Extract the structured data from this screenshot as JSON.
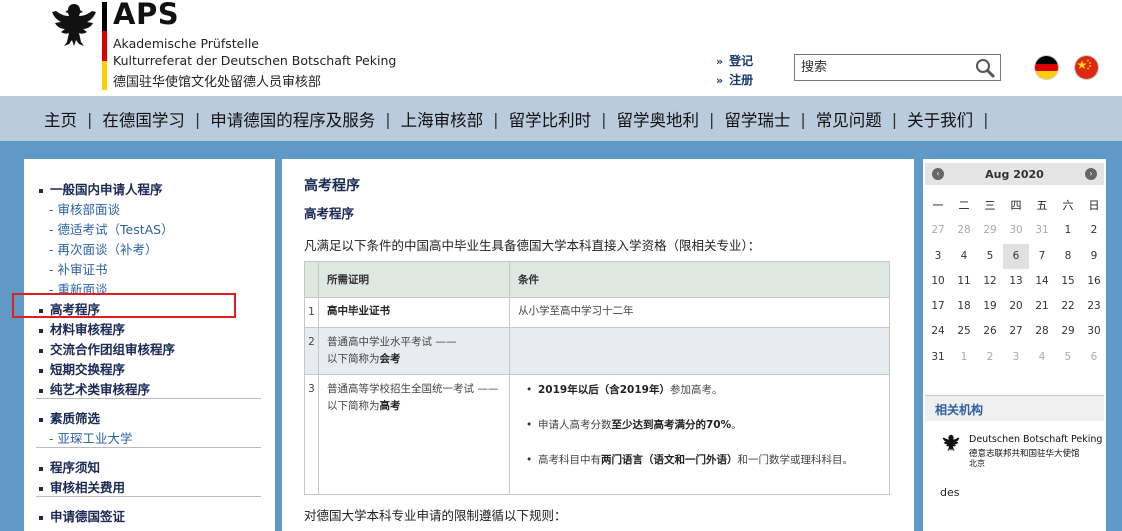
{
  "header": {
    "title": "APS",
    "subtitle_line1": "Akademische Prüfstelle",
    "subtitle_line2": "Kulturreferat der Deutschen Botschaft Peking",
    "subtitle_line3": "德国驻华使馆文化处留德人员审核部",
    "links": {
      "arrows": "»",
      "login": "登记",
      "register": "注册"
    },
    "search": {
      "placeholder": "搜索",
      "value": ""
    },
    "flags": [
      "germany-flag",
      "china-flag"
    ],
    "colors": {
      "flag_black": "#000000",
      "flag_red": "#dd0000",
      "flag_gold": "#ffce00",
      "cn_red": "#de2910",
      "cn_star": "#ffde00"
    }
  },
  "nav": {
    "separator": "|",
    "items": [
      "主页",
      "在德国学习",
      "申请德国的程序及服务",
      "上海审核部",
      "留学比利时",
      "留学奥地利",
      "留学瑞士",
      "常见问题",
      "关于我们"
    ]
  },
  "sidebar": {
    "bullet_sub_prefix": "-",
    "items": [
      {
        "label": "一般国内申请人程序",
        "level": "main"
      },
      {
        "label": "审核部面谈",
        "level": "sub"
      },
      {
        "label": "德适考试（TestAS）",
        "level": "sub"
      },
      {
        "label": "再次面谈（补考）",
        "level": "sub"
      },
      {
        "label": "补审证书",
        "level": "sub"
      },
      {
        "label": "重新面谈",
        "level": "sub"
      },
      {
        "label": "高考程序",
        "level": "main",
        "highlighted": true
      },
      {
        "label": "材料审核程序",
        "level": "main"
      },
      {
        "label": "交流合作团组审核程序",
        "level": "main"
      },
      {
        "label": "短期交换程序",
        "level": "main"
      },
      {
        "label": "纯艺术类审核程序",
        "level": "main"
      },
      {
        "label": "素质筛选",
        "level": "main"
      },
      {
        "label": "亚琛工业大学",
        "level": "sub"
      },
      {
        "label": "程序须知",
        "level": "main"
      },
      {
        "label": "审核相关费用",
        "level": "main"
      },
      {
        "label": "申请德国签证",
        "level": "main"
      }
    ]
  },
  "content": {
    "title": "高考程序",
    "subtitle": "高考程序",
    "intro": "凡满足以下条件的中国高中毕业生具备德国大学本科直接入学资格（限相关专业）：",
    "table": {
      "headers": [
        "所需证明",
        "条件"
      ],
      "rows": [
        {
          "num": "1",
          "req": "高中毕业证书",
          "cond": "从小学至高中学习十二年"
        },
        {
          "num": "2",
          "req_line1": "普通高中学业水平考试 ——",
          "req_line2_prefix": "以下简称为",
          "req_line2_bold": "会考"
        },
        {
          "num": "3",
          "req_line1": "普通高等学校招生全国统一考试 ——",
          "req_line2_prefix": "以下简称为",
          "req_line2_bold": "高考",
          "conds": [
            {
              "bold": "2019年以后（含2019年）",
              "rest": "参加高考。"
            },
            {
              "pre": "申请人高考分数",
              "bold": "至少达到高考满分的70%",
              "rest": "。"
            },
            {
              "pre": "高考科目中有",
              "bold": "两门语言（语文和一门外语）",
              "rest": "和一门数学或理科科目。"
            }
          ]
        }
      ]
    },
    "footer": "对德国大学本科专业申请的限制遵循以下规则："
  },
  "calendar": {
    "month_label": "Aug 2020",
    "prev": "‹",
    "next": "›",
    "weekdays": [
      "一",
      "二",
      "三",
      "四",
      "五",
      "六",
      "日"
    ],
    "weeks": [
      [
        27,
        28,
        29,
        30,
        31,
        1,
        2
      ],
      [
        3,
        4,
        5,
        6,
        7,
        8,
        9
      ],
      [
        10,
        11,
        12,
        13,
        14,
        15,
        16
      ],
      [
        17,
        18,
        19,
        20,
        21,
        22,
        23
      ],
      [
        24,
        25,
        26,
        27,
        28,
        29,
        30
      ],
      [
        31,
        1,
        2,
        3,
        4,
        5,
        6
      ]
    ],
    "other_month": [
      [
        0,
        0
      ],
      [
        0,
        1
      ],
      [
        0,
        2
      ],
      [
        0,
        3
      ],
      [
        0,
        4
      ],
      [
        5,
        1
      ],
      [
        5,
        2
      ],
      [
        5,
        3
      ],
      [
        5,
        4
      ],
      [
        5,
        5
      ],
      [
        5,
        6
      ]
    ],
    "today": 6
  },
  "orgs": {
    "title": "相关机构",
    "embassy_line1": "Deutschen Botschaft Peking",
    "embassy_line2": "德意志联邦共和国驻华大使馆",
    "embassy_line3": "北京",
    "extra_text": "des"
  }
}
